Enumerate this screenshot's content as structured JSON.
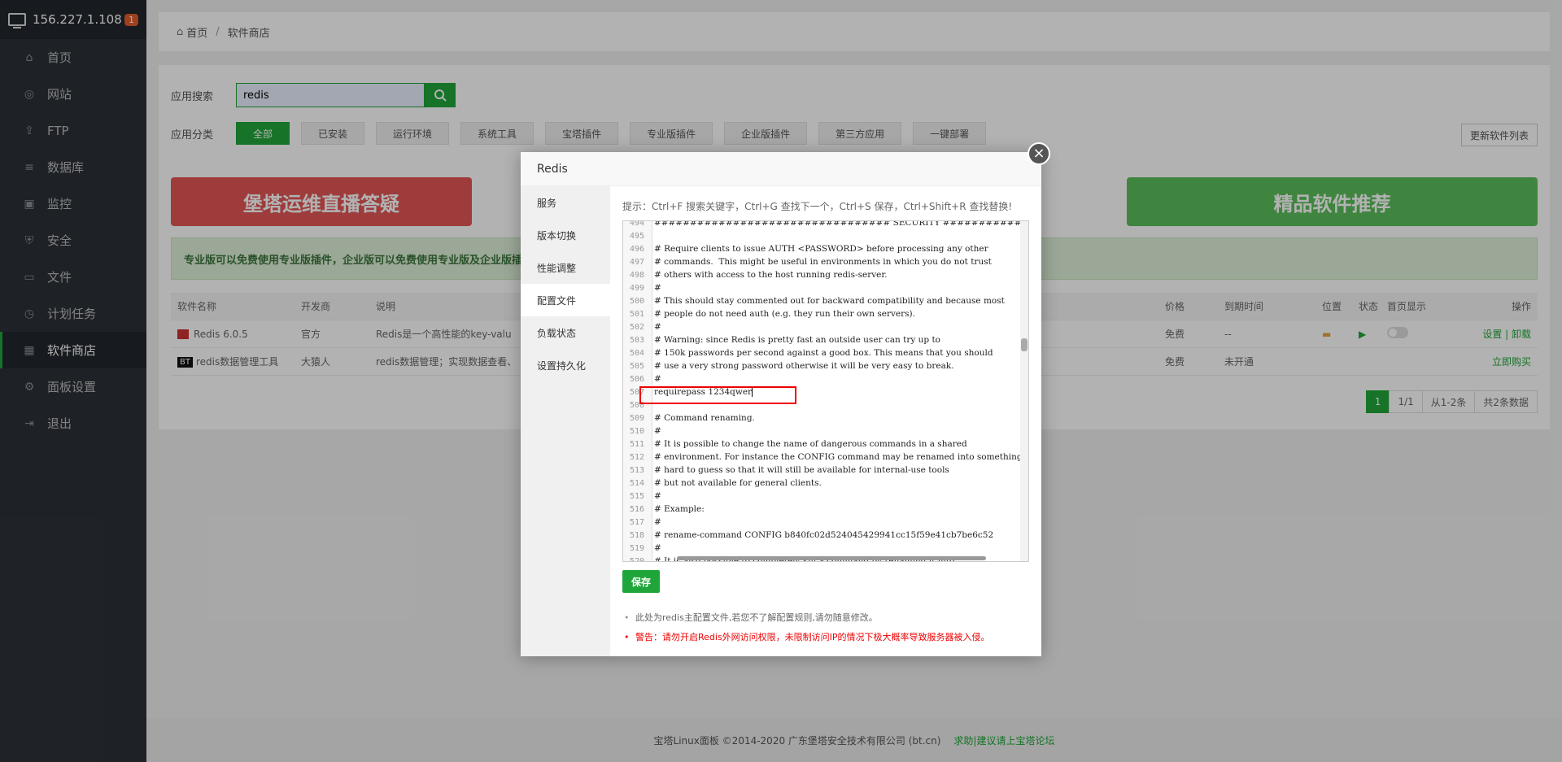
{
  "sidebar": {
    "ip": "156.227.1.108",
    "badge": "1",
    "items": [
      {
        "label": "首页",
        "icon": "home-icon"
      },
      {
        "label": "网站",
        "icon": "globe-icon"
      },
      {
        "label": "FTP",
        "icon": "ftp-icon"
      },
      {
        "label": "数据库",
        "icon": "database-icon"
      },
      {
        "label": "监控",
        "icon": "monitor-icon"
      },
      {
        "label": "安全",
        "icon": "shield-icon"
      },
      {
        "label": "文件",
        "icon": "folder-icon"
      },
      {
        "label": "计划任务",
        "icon": "clock-icon"
      },
      {
        "label": "软件商店",
        "icon": "grid-icon",
        "active": true
      },
      {
        "label": "面板设置",
        "icon": "gear-icon"
      },
      {
        "label": "退出",
        "icon": "logout-icon"
      }
    ]
  },
  "breadcrumb": {
    "home": "首页",
    "current": "软件商店"
  },
  "search": {
    "label": "应用搜索",
    "value": "redis"
  },
  "categories": {
    "label": "应用分类",
    "items": [
      "全部",
      "已安装",
      "运行环境",
      "系统工具",
      "宝塔插件",
      "专业版插件",
      "企业版插件",
      "第三方应用",
      "一键部署"
    ]
  },
  "refresh_label": "更新软件列表",
  "banners": {
    "left": "堡塔运维直播答疑",
    "right": "精品软件推荐"
  },
  "notice": "专业版可以免费使用专业版插件，企业版可以免费使用专业版及企业版插",
  "table": {
    "headers": [
      "软件名称",
      "开发商",
      "说明",
      "价格",
      "到期时间",
      "位置",
      "状态",
      "首页显示",
      "操作"
    ],
    "rows": [
      {
        "name": "Redis 6.0.5",
        "dev": "官方",
        "desc": "Redis是一个高性能的key-valu",
        "price": "免费",
        "exp": "--",
        "op": "设置 | 卸载"
      },
      {
        "name": "redis数据管理工具",
        "dev": "大猿人",
        "desc": "redis数据管理；实现数据查看、",
        "price": "免费",
        "exp": "未开通",
        "op": "立即购买"
      }
    ]
  },
  "pager": {
    "page": "1",
    "pages": "1/1",
    "range": "从1-2条",
    "total": "共2条数据"
  },
  "footer": {
    "copyright": "宝塔Linux面板 ©2014-2020 广东堡塔安全技术有限公司 (bt.cn)",
    "link": "求助|建议请上宝塔论坛"
  },
  "modal": {
    "title": "Redis",
    "tabs": [
      "服务",
      "版本切换",
      "性能调整",
      "配置文件",
      "负载状态",
      "设置持久化"
    ],
    "active_tab": "配置文件",
    "tip": "提示：Ctrl+F 搜索关键字，Ctrl+G 查找下一个，Ctrl+S 保存，Ctrl+Shift+R 查找替换!",
    "lines": [
      {
        "n": "494",
        "t": "################################# SECURITY ##################################"
      },
      {
        "n": "495",
        "t": ""
      },
      {
        "n": "496",
        "t": "# Require clients to issue AUTH <PASSWORD> before processing any other"
      },
      {
        "n": "497",
        "t": "# commands.  This might be useful in environments in which you do not trust"
      },
      {
        "n": "498",
        "t": "# others with access to the host running redis-server."
      },
      {
        "n": "499",
        "t": "#"
      },
      {
        "n": "500",
        "t": "# This should stay commented out for backward compatibility and because most"
      },
      {
        "n": "501",
        "t": "# people do not need auth (e.g. they run their own servers)."
      },
      {
        "n": "502",
        "t": "#"
      },
      {
        "n": "503",
        "t": "# Warning: since Redis is pretty fast an outside user can try up to"
      },
      {
        "n": "504",
        "t": "# 150k passwords per second against a good box. This means that you should"
      },
      {
        "n": "505",
        "t": "# use a very strong password otherwise it will be very easy to break."
      },
      {
        "n": "506",
        "t": "#"
      },
      {
        "n": "507",
        "t": "requirepass 1234qwer"
      },
      {
        "n": "508",
        "t": ""
      },
      {
        "n": "509",
        "t": "# Command renaming."
      },
      {
        "n": "510",
        "t": "#"
      },
      {
        "n": "511",
        "t": "# It is possible to change the name of dangerous commands in a shared"
      },
      {
        "n": "512",
        "t": "# environment. For instance the CONFIG command may be renamed into something"
      },
      {
        "n": "513",
        "t": "# hard to guess so that it will still be available for internal-use tools"
      },
      {
        "n": "514",
        "t": "# but not available for general clients."
      },
      {
        "n": "515",
        "t": "#"
      },
      {
        "n": "516",
        "t": "# Example:"
      },
      {
        "n": "517",
        "t": "#"
      },
      {
        "n": "518",
        "t": "# rename-command CONFIG b840fc02d524045429941cc15f59e41cb7be6c52"
      },
      {
        "n": "519",
        "t": "#"
      },
      {
        "n": "520",
        "t": "# It is also possible to completely kill a command by renaming it into"
      }
    ],
    "save_label": "保存",
    "note": "此处为redis主配置文件,若您不了解配置规则,请勿随意修改。",
    "warning": "警告：请勿开启Redis外网访问权限，未限制访问IP的情况下极大概率导致服务器被入侵。"
  }
}
